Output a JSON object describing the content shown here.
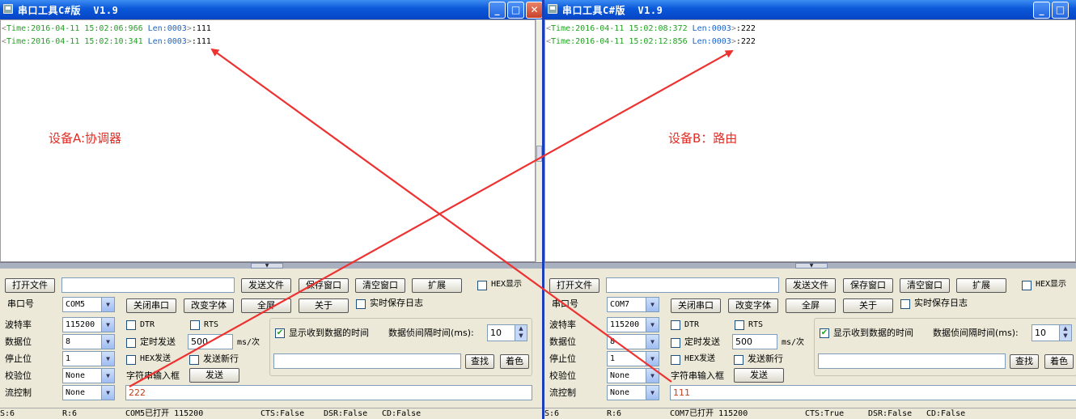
{
  "window_a": {
    "title": "串口工具C#版  V1.9",
    "log": [
      {
        "open": "<",
        "time": "Time:2016-04-11 15:02:06:966",
        "len": "Len:0003",
        "close": ">",
        "data": ":111"
      },
      {
        "open": "<",
        "time": "Time:2016-04-11 15:02:10:341",
        "len": "Len:0003",
        "close": ">",
        "data": ":111"
      }
    ],
    "annotation": "设备A:协调器",
    "buttons": {
      "open_file": "打开文件",
      "send_file": "发送文件",
      "save_window": "保存窗口",
      "clear_window": "清空窗口",
      "expand": "扩展",
      "close_port": "关闭串口",
      "change_font": "改变字体",
      "fullscreen": "全屏",
      "about": "关于",
      "send": "发送",
      "find": "查找",
      "color": "着色"
    },
    "labels": {
      "hex_show": "HEX显示",
      "port_no": "串口号",
      "realtime_log": "实时保存日志",
      "baud": "波特率",
      "data_bits": "数据位",
      "stop_bits": "停止位",
      "parity": "校验位",
      "flow": "流控制",
      "dtr": "DTR",
      "rts": "RTS",
      "timed_send": "定时发送",
      "interval_unit": "ms/次",
      "hex_send": "HEX发送",
      "send_newline": "发送新行",
      "string_input": "字符串输入框",
      "show_time": "显示收到数据的时间",
      "frame_interval": "数据侦间隔时间(ms):"
    },
    "values": {
      "file_path": "",
      "port": "COM5",
      "baud": "115200",
      "data_bits": "8",
      "stop_bits": "1",
      "parity": "None",
      "flow": "None",
      "interval": "500",
      "frame_interval": "10",
      "search": "",
      "send_text": "222"
    },
    "status": {
      "s": "S:6",
      "r": "R:6",
      "port": "COM5已打开  115200",
      "cts": "CTS:False",
      "dsr": "DSR:False",
      "cd": "CD:False"
    }
  },
  "window_b": {
    "title": "串口工具C#版  V1.9",
    "log": [
      {
        "open": "<",
        "time": "Time:2016-04-11 15:02:08:372",
        "len": "Len:0003",
        "close": ">",
        "data": ":222"
      },
      {
        "open": "<",
        "time": "Time:2016-04-11 15:02:12:856",
        "len": "Len:0003",
        "close": ">",
        "data": ":222"
      }
    ],
    "annotation": "设备B：路由",
    "buttons": {
      "open_file": "打开文件",
      "send_file": "发送文件",
      "save_window": "保存窗口",
      "clear_window": "清空窗口",
      "expand": "扩展",
      "close_port": "关闭串口",
      "change_font": "改变字体",
      "fullscreen": "全屏",
      "about": "关于",
      "send": "发送",
      "find": "查找",
      "color": "着色"
    },
    "labels": {
      "hex_show": "HEX显示",
      "port_no": "串口号",
      "realtime_log": "实时保存日志",
      "baud": "波特率",
      "data_bits": "数据位",
      "stop_bits": "停止位",
      "parity": "校验位",
      "flow": "流控制",
      "dtr": "DTR",
      "rts": "RTS",
      "timed_send": "定时发送",
      "interval_unit": "ms/次",
      "hex_send": "HEX发送",
      "send_newline": "发送新行",
      "string_input": "字符串输入框",
      "show_time": "显示收到数据的时间",
      "frame_interval": "数据侦间隔时间(ms):"
    },
    "values": {
      "file_path": "",
      "port": "COM7",
      "baud": "115200",
      "data_bits": "8",
      "stop_bits": "1",
      "parity": "None",
      "flow": "None",
      "interval": "500",
      "frame_interval": "10",
      "search": "",
      "send_text": "111"
    },
    "status": {
      "s": "S:6",
      "r": "R:6",
      "port": "COM7已打开  115200",
      "cts": "CTS:True",
      "dsr": "DSR:False",
      "cd": "CD:False"
    }
  },
  "colors": {
    "annotation": "#e02c24",
    "time_text": "#22a022",
    "len_text": "#1b63c8",
    "titlebar": "#0a58d8"
  }
}
